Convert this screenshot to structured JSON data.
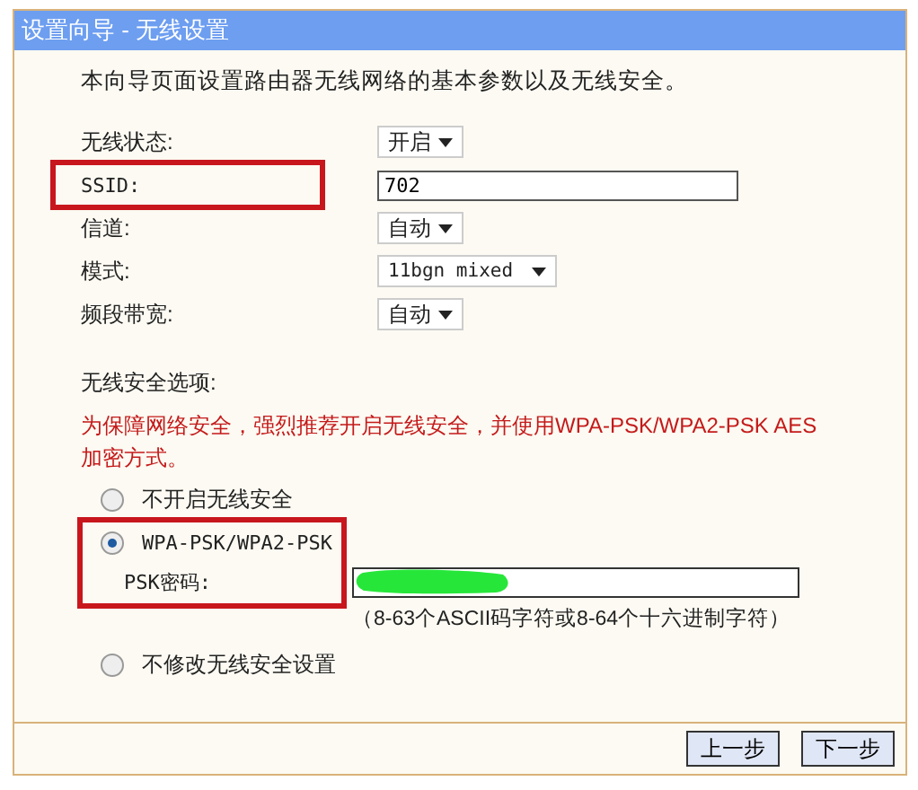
{
  "window": {
    "title": "设置向导 - 无线设置"
  },
  "intro": "本向导页面设置路由器无线网络的基本参数以及无线安全。",
  "fields": [
    {
      "kind": "select",
      "label": "无线状态:",
      "value": "开启",
      "highlighted": false
    },
    {
      "kind": "text",
      "label": "SSID:",
      "value": "702",
      "highlighted": true
    },
    {
      "kind": "select",
      "label": "信道:",
      "value": "自动",
      "highlighted": false
    },
    {
      "kind": "select",
      "label": "模式:",
      "value": "11bgn mixed",
      "highlighted": false
    },
    {
      "kind": "select",
      "label": "频段带宽:",
      "value": "自动",
      "highlighted": false
    }
  ],
  "security": {
    "label": "无线安全选项:",
    "warning": "为保障网络安全，强烈推荐开启无线安全，并使用WPA-PSK/WPA2-PSK AES加密方式。",
    "options": [
      {
        "label": "不开启无线安全",
        "selected": false,
        "highlighted": false
      },
      {
        "label": "WPA-PSK/WPA2-PSK",
        "selected": true,
        "highlighted": true,
        "password_label": "PSK密码:",
        "hint": "（8-63个ASCII码字符或8-64个十六进制字符）"
      },
      {
        "label": "不修改无线安全设置",
        "selected": false,
        "highlighted": false
      }
    ]
  },
  "buttons": [
    "上一步",
    "下一步"
  ]
}
